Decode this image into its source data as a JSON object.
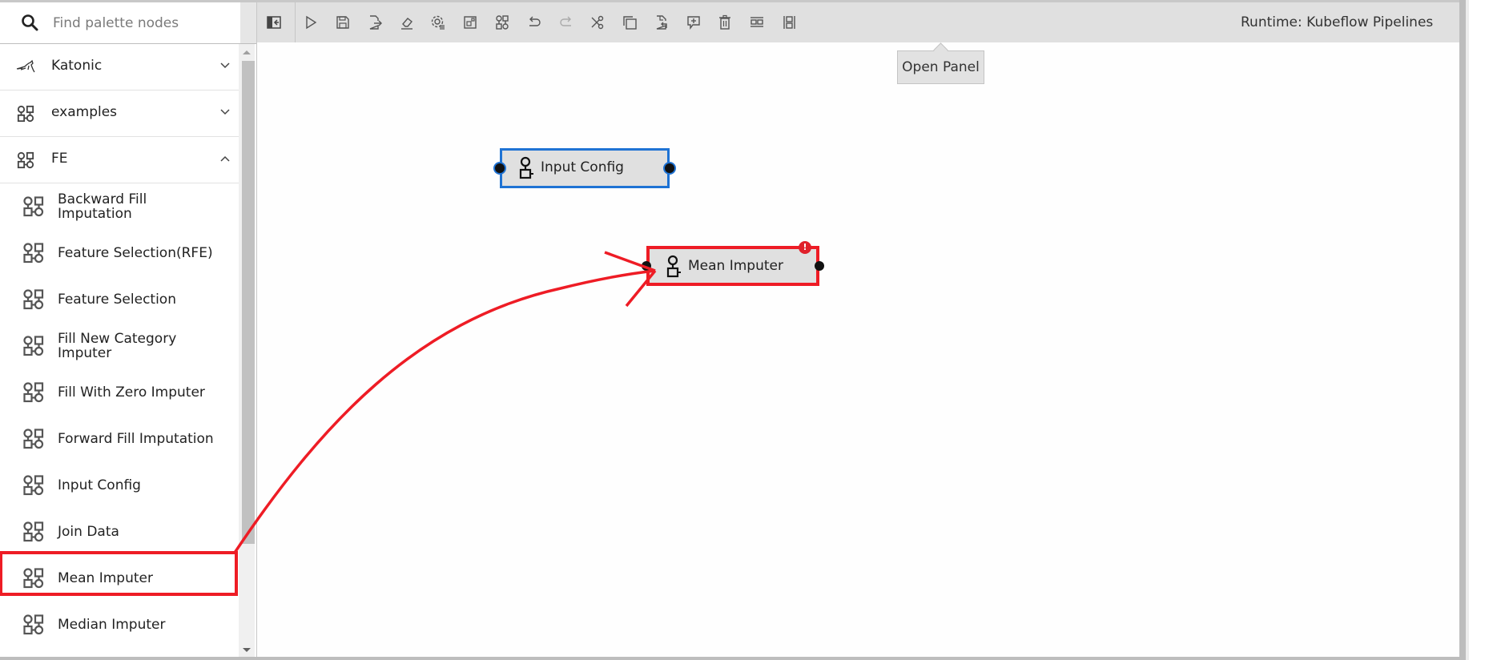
{
  "palette": {
    "search_placeholder": "Find palette nodes",
    "categories": [
      {
        "label": "Katonic",
        "icon": "kangaroo-logo-icon",
        "expanded": false
      },
      {
        "label": "examples",
        "icon": "pipeline-nodes-icon",
        "expanded": false
      },
      {
        "label": "FE",
        "icon": "pipeline-nodes-icon",
        "expanded": true
      }
    ],
    "items": [
      {
        "label": "Backward Fill Imputation",
        "lines": [
          "Backward Fill",
          "Imputation"
        ]
      },
      {
        "label": "Feature Selection(RFE)",
        "lines": [
          "Feature Selection(RFE)"
        ]
      },
      {
        "label": "Feature Selection",
        "lines": [
          "Feature Selection"
        ]
      },
      {
        "label": "Fill New Category Imputer",
        "lines": [
          "Fill New Category",
          "Imputer"
        ]
      },
      {
        "label": "Fill With Zero Imputer",
        "lines": [
          "Fill With Zero Imputer"
        ]
      },
      {
        "label": "Forward Fill Imputation",
        "lines": [
          "Forward Fill Imputation"
        ]
      },
      {
        "label": "Input Config",
        "lines": [
          "Input Config"
        ]
      },
      {
        "label": "Join Data",
        "lines": [
          "Join Data"
        ]
      },
      {
        "label": "Mean Imputer",
        "lines": [
          "Mean Imputer"
        ],
        "highlighted": true
      },
      {
        "label": "Median Imputer",
        "lines": [
          "Median Imputer"
        ]
      }
    ]
  },
  "toolbar": {
    "buttons": [
      {
        "name": "open-palette",
        "icon": "panel-left-icon"
      },
      {
        "name": "run-pipeline",
        "icon": "play-icon"
      },
      {
        "name": "save-pipeline",
        "icon": "save-icon"
      },
      {
        "name": "export-pipeline",
        "icon": "export-icon"
      },
      {
        "name": "clear-pipeline",
        "icon": "eraser-icon"
      },
      {
        "name": "open-runtimes",
        "icon": "runtimes-settings-icon"
      },
      {
        "name": "open-runtime-images",
        "icon": "runtime-images-icon"
      },
      {
        "name": "open-component-catalogs",
        "icon": "pipeline-nodes-icon"
      },
      {
        "name": "undo",
        "icon": "undo-icon"
      },
      {
        "name": "redo",
        "icon": "redo-icon",
        "disabled": true
      },
      {
        "name": "cut",
        "icon": "scissors-icon"
      },
      {
        "name": "copy",
        "icon": "copy-icon"
      },
      {
        "name": "paste",
        "icon": "paste-icon"
      },
      {
        "name": "add-comment",
        "icon": "comment-add-icon"
      },
      {
        "name": "delete",
        "icon": "trash-icon"
      },
      {
        "name": "arrange-horizontal",
        "icon": "arrange-horizontal-icon"
      },
      {
        "name": "arrange-vertical",
        "icon": "arrange-vertical-icon"
      }
    ],
    "runtime_label": "Runtime: Kubeflow Pipelines",
    "open_panel_tooltip": "Open Panel"
  },
  "canvas": {
    "nodes": [
      {
        "label": "Input Config",
        "selected": true,
        "error": false
      },
      {
        "label": "Mean Imputer",
        "selected": false,
        "error": true
      }
    ]
  },
  "colors": {
    "selection_blue": "#1f73d4",
    "annotation_red": "#ee1c25",
    "toolbar_bg": "#e0e0e0",
    "node_bg": "#e0e0e0"
  }
}
